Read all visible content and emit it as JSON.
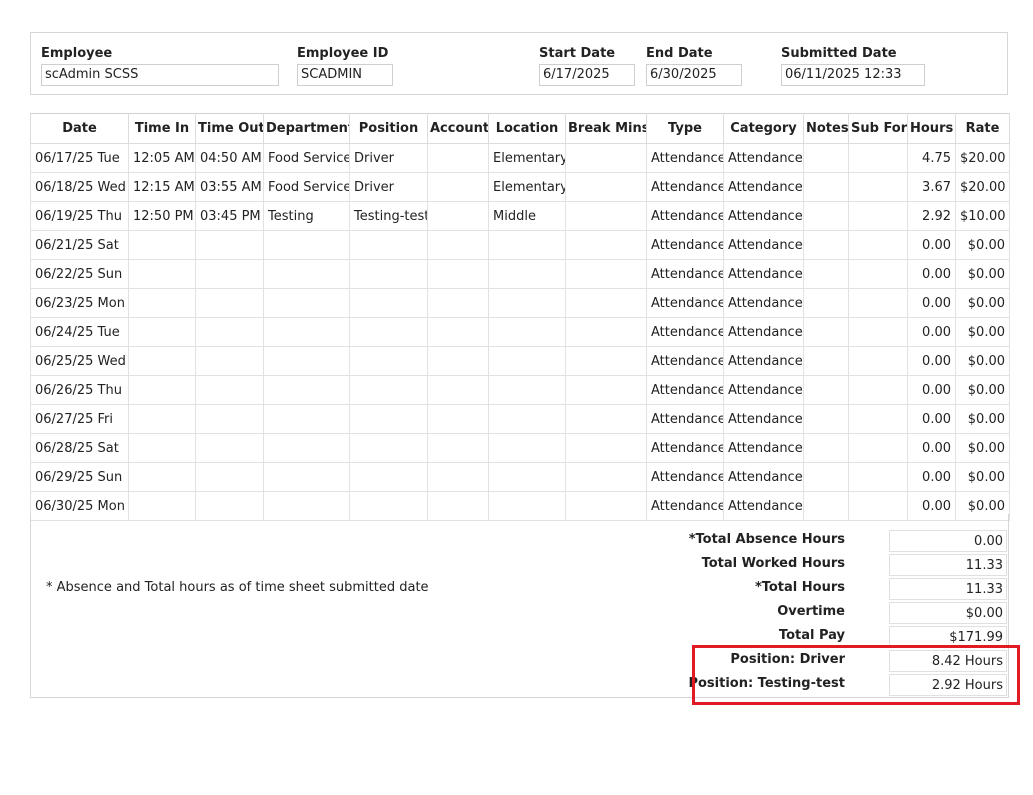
{
  "header": {
    "employee_label": "Employee",
    "employee_value": "scAdmin SCSS",
    "employee_id_label": "Employee ID",
    "employee_id_value": "SCADMIN",
    "start_date_label": "Start Date",
    "start_date_value": "6/17/2025",
    "end_date_label": "End Date",
    "end_date_value": "6/30/2025",
    "submitted_date_label": "Submitted Date",
    "submitted_date_value": "06/11/2025 12:33"
  },
  "table": {
    "columns": [
      "Date",
      "Time In",
      "Time Out",
      "Department",
      "Position",
      "Account",
      "Location",
      "Break Mins",
      "Type",
      "Category",
      "Notes",
      "Sub For",
      "Hours",
      "Rate"
    ],
    "rows": [
      [
        "06/17/25 Tue",
        "12:05 AM",
        "04:50 AM",
        "Food Service",
        "Driver",
        "",
        "Elementary",
        "",
        "Attendance",
        "Attendance",
        "",
        "",
        "4.75",
        "$20.00"
      ],
      [
        "06/18/25 Wed",
        "12:15 AM",
        "03:55 AM",
        "Food Service",
        "Driver",
        "",
        "Elementary",
        "",
        "Attendance",
        "Attendance",
        "",
        "",
        "3.67",
        "$20.00"
      ],
      [
        "06/19/25 Thu",
        "12:50 PM",
        "03:45 PM",
        "Testing",
        "Testing-test",
        "",
        "Middle",
        "",
        "Attendance",
        "Attendance",
        "",
        "",
        "2.92",
        "$10.00"
      ],
      [
        "06/21/25 Sat",
        "",
        "",
        "",
        "",
        "",
        "",
        "",
        "Attendance",
        "Attendance",
        "",
        "",
        "0.00",
        "$0.00"
      ],
      [
        "06/22/25 Sun",
        "",
        "",
        "",
        "",
        "",
        "",
        "",
        "Attendance",
        "Attendance",
        "",
        "",
        "0.00",
        "$0.00"
      ],
      [
        "06/23/25 Mon",
        "",
        "",
        "",
        "",
        "",
        "",
        "",
        "Attendance",
        "Attendance",
        "",
        "",
        "0.00",
        "$0.00"
      ],
      [
        "06/24/25 Tue",
        "",
        "",
        "",
        "",
        "",
        "",
        "",
        "Attendance",
        "Attendance",
        "",
        "",
        "0.00",
        "$0.00"
      ],
      [
        "06/25/25 Wed",
        "",
        "",
        "",
        "",
        "",
        "",
        "",
        "Attendance",
        "Attendance",
        "",
        "",
        "0.00",
        "$0.00"
      ],
      [
        "06/26/25 Thu",
        "",
        "",
        "",
        "",
        "",
        "",
        "",
        "Attendance",
        "Attendance",
        "",
        "",
        "0.00",
        "$0.00"
      ],
      [
        "06/27/25 Fri",
        "",
        "",
        "",
        "",
        "",
        "",
        "",
        "Attendance",
        "Attendance",
        "",
        "",
        "0.00",
        "$0.00"
      ],
      [
        "06/28/25 Sat",
        "",
        "",
        "",
        "",
        "",
        "",
        "",
        "Attendance",
        "Attendance",
        "",
        "",
        "0.00",
        "$0.00"
      ],
      [
        "06/29/25 Sun",
        "",
        "",
        "",
        "",
        "",
        "",
        "",
        "Attendance",
        "Attendance",
        "",
        "",
        "0.00",
        "$0.00"
      ],
      [
        "06/30/25 Mon",
        "",
        "",
        "",
        "",
        "",
        "",
        "",
        "Attendance",
        "Attendance",
        "",
        "",
        "0.00",
        "$0.00"
      ]
    ]
  },
  "footnote": "* Absence and Total hours as of time sheet submitted date",
  "summary": {
    "total_absence_label": "*Total Absence Hours",
    "total_absence_value": "0.00",
    "total_worked_label": "Total Worked Hours",
    "total_worked_value": "11.33",
    "total_hours_label": "*Total Hours",
    "total_hours_value": "11.33",
    "overtime_label": "Overtime",
    "overtime_value": "$0.00",
    "total_pay_label": "Total Pay",
    "total_pay_value": "$171.99",
    "position_driver_label": "Position: Driver",
    "position_driver_value": "8.42 Hours",
    "position_testing_label": "Position: Testing-test",
    "position_testing_value": "2.92 Hours"
  },
  "colors": {
    "highlight": "#e01b24",
    "border": "#d6d6d6"
  }
}
